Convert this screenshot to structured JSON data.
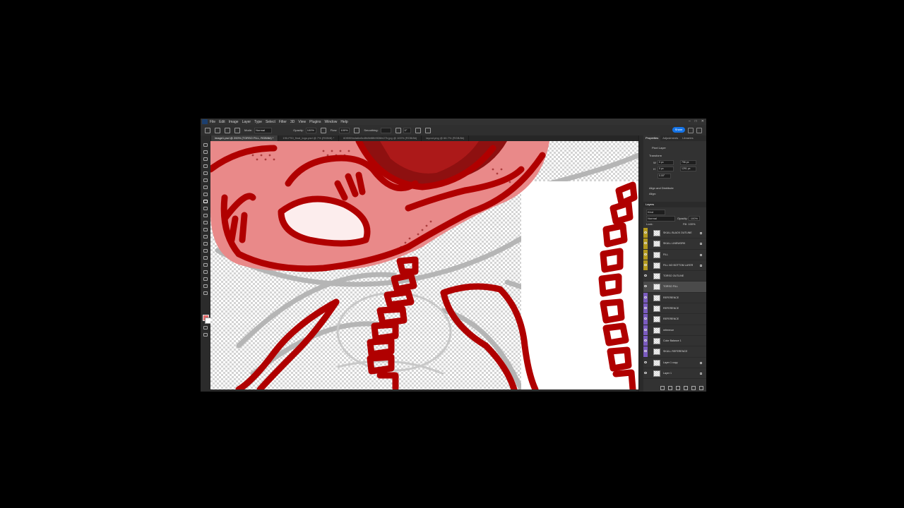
{
  "app": {
    "menu": [
      "File",
      "Edit",
      "Image",
      "Layer",
      "Type",
      "Select",
      "Filter",
      "3D",
      "View",
      "Plugins",
      "Window",
      "Help"
    ]
  },
  "options": {
    "mode_label": "Mode:",
    "mode_value": "Normal",
    "opacity_label": "Opacity:",
    "opacity_value": "100%",
    "flow_label": "Flow:",
    "flow_value": "100%",
    "smoothing_label": "Smoothing:",
    "angle_value": "0°",
    "share_label": "Share"
  },
  "tabs": [
    {
      "label": "image1.psd @ 200% (TORSO FILL, RGB/8#) *",
      "active": true
    },
    {
      "label": "190-FS0_final_logo.psd @ 7% (RGB/8) *",
      "active": false
    },
    {
      "label": "60f0f09a4a6a5c4fb8bf8fb9f26fe27b.jpg @ 100% (RGB/8#)",
      "active": false
    },
    {
      "label": "layout.png @ 66.7% (RGB/8#)",
      "active": false
    }
  ],
  "properties": {
    "tabs": [
      "Properties",
      "Adjustments",
      "Libraries"
    ],
    "layer_kind": "Pixel Layer",
    "transform_label": "Transform",
    "w_label": "W",
    "w_value": "0 px",
    "x_value": "796 px",
    "h_label": "H",
    "h_value": "0 px",
    "y_value": "1291 px",
    "angle_value": "0.00°",
    "align_label": "Align and Distribute",
    "align_sub": "Align:"
  },
  "layers": {
    "header": "Layers",
    "filter_kind": "Kind",
    "blend_mode": "Normal",
    "opacity_label": "Opacity:",
    "opacity_value": "100%",
    "lock_label": "Lock:",
    "fill_label": "Fill:",
    "fill_value": "100%",
    "items": [
      {
        "name": "SKULL BLACK OUTLINE",
        "tag_color": "#b49a1e",
        "locked": true,
        "selected": false
      },
      {
        "name": "SKULL LINEWORK",
        "tag_color": "#b49a1e",
        "locked": true,
        "selected": false
      },
      {
        "name": "FILL",
        "tag_color": "#b49a1e",
        "locked": true,
        "selected": false
      },
      {
        "name": "FILL NO BOTTOM LAYER",
        "tag_color": "#b49a1e",
        "locked": true,
        "selected": false
      },
      {
        "name": "TORSO OUTLINE",
        "tag_color": "",
        "locked": false,
        "selected": false
      },
      {
        "name": "TORSO FILL",
        "tag_color": "",
        "locked": false,
        "selected": true
      },
      {
        "name": "REFERENCE",
        "tag_color": "#7a5bbf",
        "locked": false,
        "selected": false
      },
      {
        "name": "REFERENCE",
        "tag_color": "#7a5bbf",
        "locked": false,
        "selected": false
      },
      {
        "name": "REFERENCE",
        "tag_color": "#7a5bbf",
        "locked": false,
        "selected": false
      },
      {
        "name": "reference",
        "tag_color": "#7a5bbf",
        "locked": false,
        "selected": false
      },
      {
        "name": "Color Balance 1",
        "tag_color": "#7a5bbf",
        "locked": false,
        "selected": false
      },
      {
        "name": "SKULL REFERENCE",
        "tag_color": "#7a5bbf",
        "locked": false,
        "selected": false
      },
      {
        "name": "Layer 1 copy",
        "tag_color": "",
        "locked": true,
        "selected": false
      },
      {
        "name": "Layer 1",
        "tag_color": "",
        "locked": true,
        "selected": false
      }
    ]
  },
  "colors": {
    "foreground": "#e46a6a",
    "background": "#ffffff",
    "accent": "#1473e6",
    "ink_red": "#b00000"
  }
}
